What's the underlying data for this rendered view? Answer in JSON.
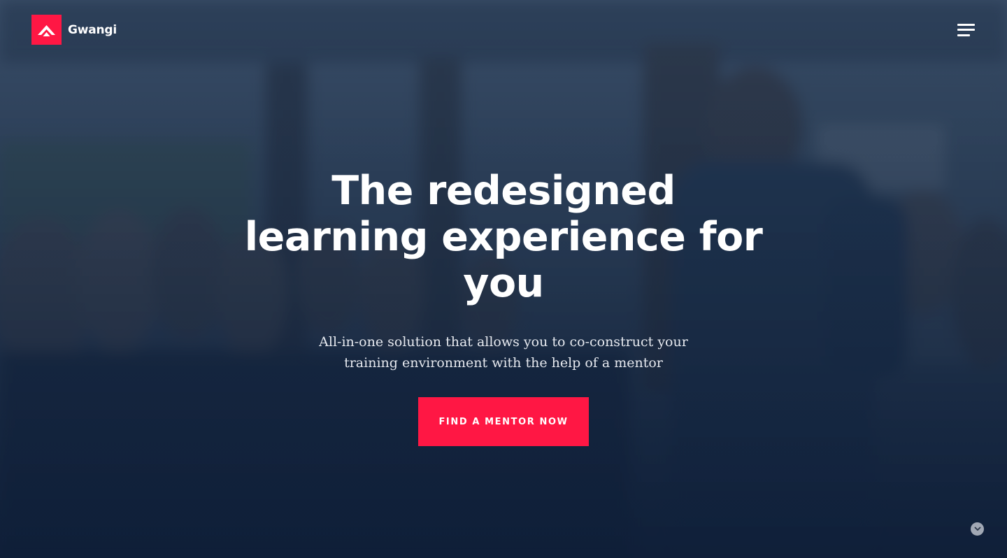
{
  "brand": {
    "name": "Gwangi",
    "logo_icon": "mountain-chevron-icon",
    "accent_color": "#ff1744"
  },
  "header": {
    "menu_icon": "hamburger-menu-icon"
  },
  "hero": {
    "headline": "The redesigned learning experience for you",
    "subtext": "All-in-one solution that allows you to co-construct your training environment with the help of a mentor",
    "cta_label": "FIND A MENTOR NOW",
    "scroll_icon": "chevron-down-icon"
  }
}
